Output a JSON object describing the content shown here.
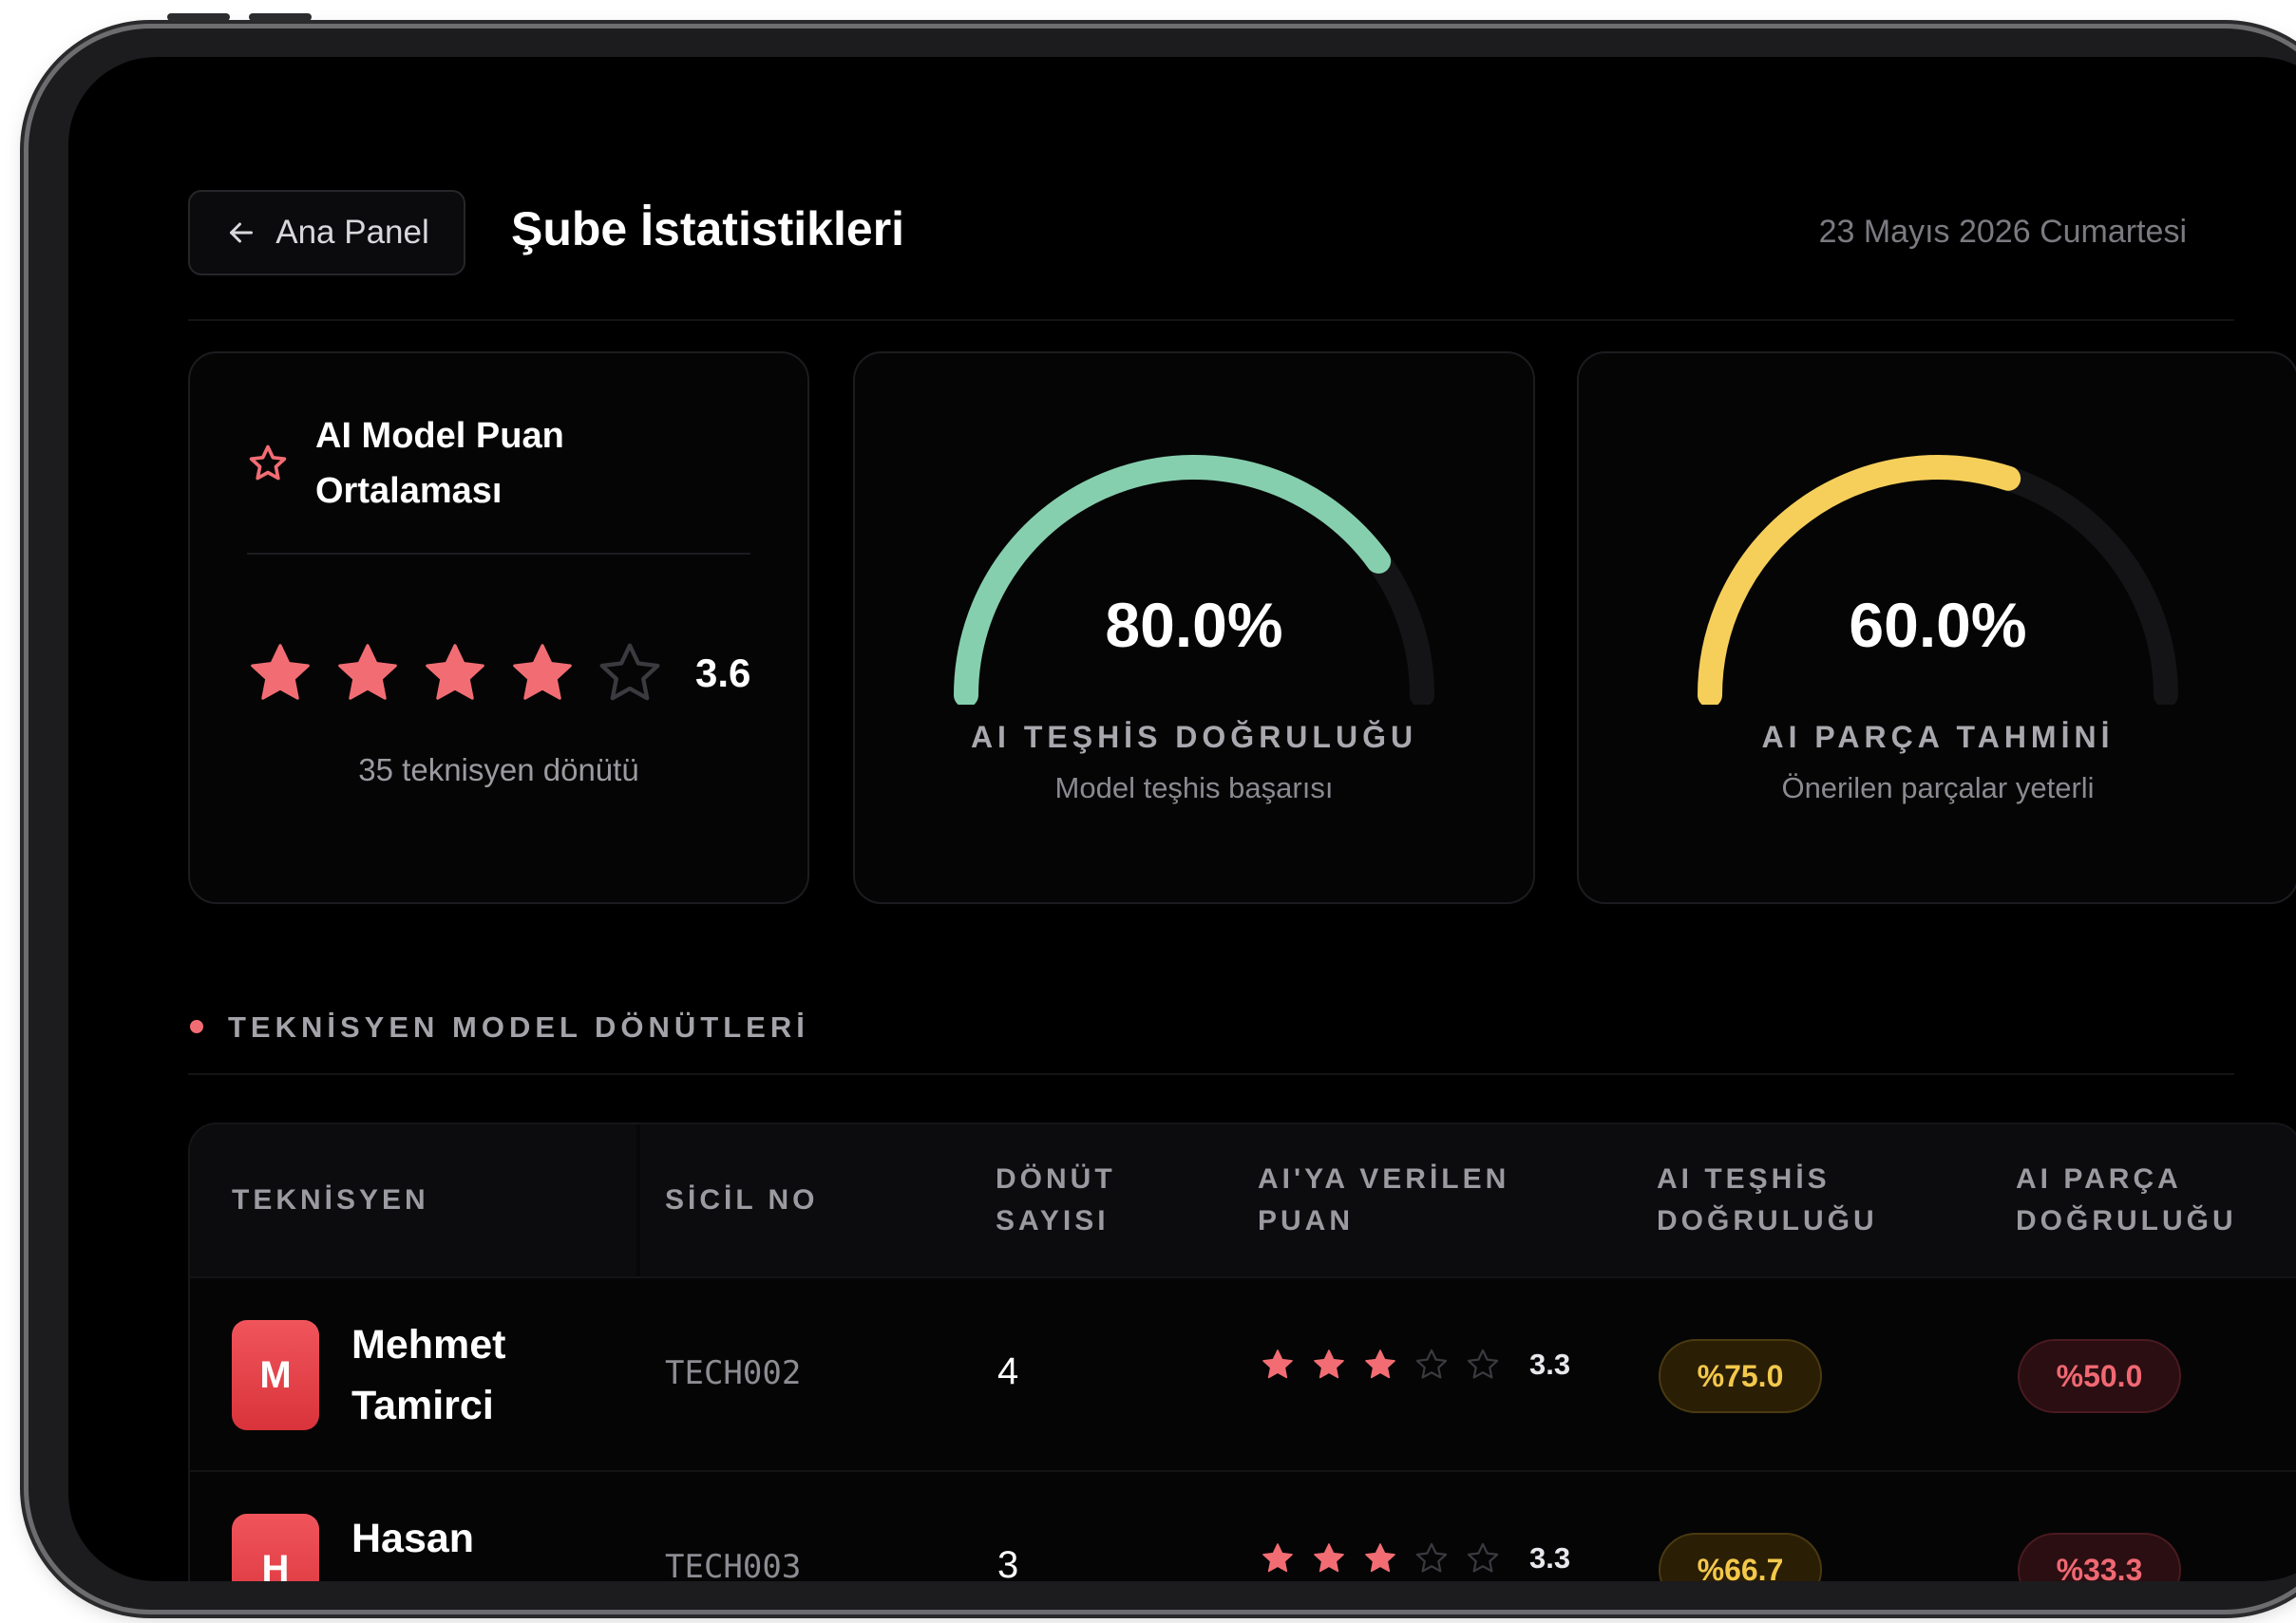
{
  "header": {
    "back_label": "Ana Panel",
    "title": "Şube İstatistikleri",
    "date": "23 Mayıs 2026 Cumartesi"
  },
  "rating_card": {
    "title": "AI Model Puan Ortalaması",
    "rating": 3.6,
    "rating_text": "3.6",
    "max_stars": 5,
    "filled_stars": 4,
    "subtitle": "35 teknisyen dönütü"
  },
  "gauges": [
    {
      "value_text": "80.0%",
      "value": 80.0,
      "label": "AI TEŞHİS DOĞRULUĞU",
      "sub": "Model teşhis başarısı",
      "color": "#86cfae"
    },
    {
      "value_text": "60.0%",
      "value": 60.0,
      "label": "AI PARÇA TAHMİNİ",
      "sub": "Önerilen parçalar yeterli",
      "color": "#f6cf5a"
    }
  ],
  "section": {
    "title": "TEKNİSYEN MODEL DÖNÜTLERİ"
  },
  "table": {
    "headers": [
      "TEKNİSYEN",
      "SİCİL NO",
      "DÖNÜT SAYISI",
      "AI'YA VERİLEN PUAN",
      "AI TEŞHİS DOĞRULUĞU",
      "AI PARÇA DOĞRULUĞU"
    ],
    "rows": [
      {
        "initial": "M",
        "name": "Mehmet Tamirci",
        "sicil": "TECH002",
        "count": "4",
        "rating": 3.3,
        "rating_text": "3.3",
        "filled": 3,
        "diag": "%75.0",
        "parts": "%50.0"
      },
      {
        "initial": "H",
        "name": "Hasan Elektrikçi",
        "sicil": "TECH003",
        "count": "3",
        "rating": 3.3,
        "rating_text": "3.3",
        "filled": 3,
        "diag": "%66.7",
        "parts": "%33.3"
      }
    ]
  },
  "colors": {
    "accent": "#f26d73",
    "star_filled": "#f26d73",
    "star_empty": "#3a3a3f",
    "gauge_track": "#141416"
  },
  "icons": {
    "back": "arrow-left-icon",
    "rating": "star-outline-icon",
    "filled_star": "star-filled-icon",
    "empty_star": "star-outline-icon"
  }
}
